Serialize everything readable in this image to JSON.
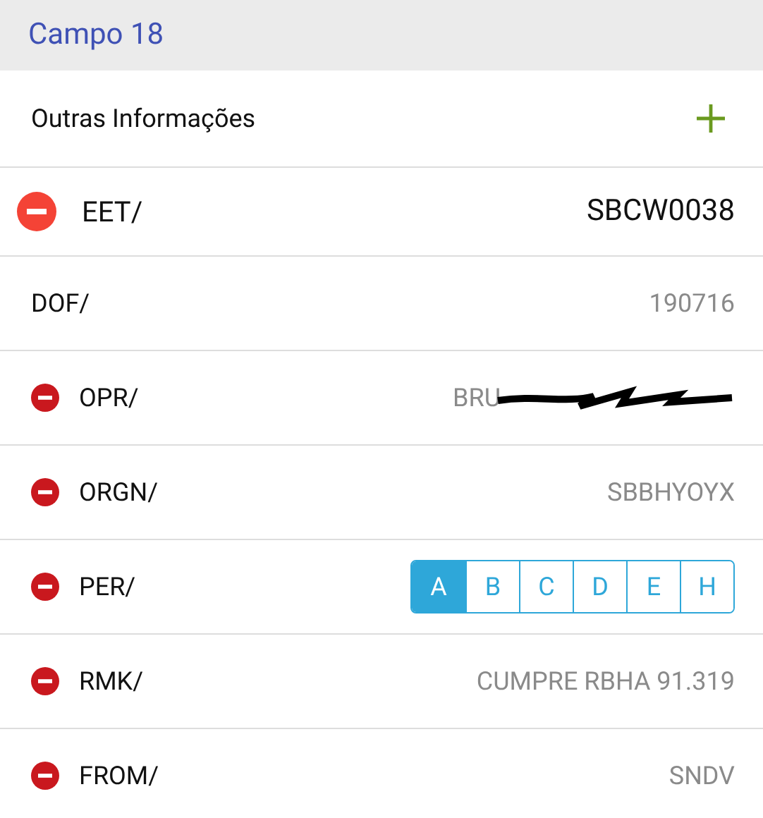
{
  "header": {
    "title": "Campo 18"
  },
  "section": {
    "title": "Outras Informações"
  },
  "rows": [
    {
      "kind": "text",
      "label": "EET/",
      "value": "SBCW0038",
      "removable": true,
      "editing": true
    },
    {
      "kind": "text",
      "label": "DOF/",
      "value": "190716",
      "removable": false,
      "editing": false
    },
    {
      "kind": "text",
      "label": "OPR/",
      "value": "BRU",
      "redacted": true,
      "removable": true,
      "editing": false
    },
    {
      "kind": "text",
      "label": "ORGN/",
      "value": "SBBHYOYX",
      "removable": true,
      "editing": false
    },
    {
      "kind": "segmented",
      "label": "PER/",
      "options": [
        {
          "label": "A",
          "selected": true
        },
        {
          "label": "B",
          "selected": false
        },
        {
          "label": "C",
          "selected": false
        },
        {
          "label": "D",
          "selected": false
        },
        {
          "label": "E",
          "selected": false
        },
        {
          "label": "H",
          "selected": false
        }
      ],
      "removable": true,
      "editing": false
    },
    {
      "kind": "text",
      "label": "RMK/",
      "value": "CUMPRE RBHA 91.319",
      "removable": true,
      "editing": false
    },
    {
      "kind": "text",
      "label": "FROM/",
      "value": "SNDV",
      "removable": true,
      "editing": false
    }
  ]
}
